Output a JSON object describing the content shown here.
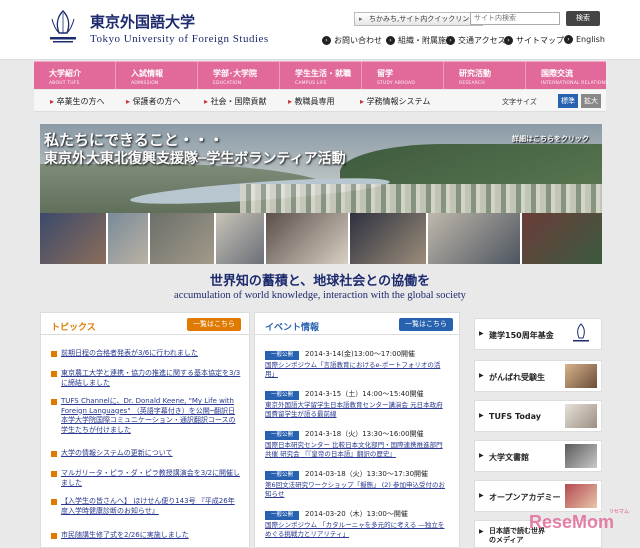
{
  "header": {
    "logo_ja": "東京外国語大学",
    "logo_en": "Tokyo University of Foreign Studies",
    "quicklink": "ちかみち,サイト内クイックリンク",
    "search_placeholder": "サイト内検索",
    "search_button": "検索",
    "util": [
      "お問い合わせ",
      "組織・附属施設",
      "交通アクセス",
      "サイトマップ",
      "English"
    ]
  },
  "nav": [
    {
      "ja": "大学紹介",
      "en": "ABOUT TUFS"
    },
    {
      "ja": "入試情報",
      "en": "ADMISSION"
    },
    {
      "ja": "学部･大学院",
      "en": "EDUCATION"
    },
    {
      "ja": "学生生活・就職",
      "en": "CAMPUS LIFE"
    },
    {
      "ja": "留学",
      "en": "STUDY ABROAD"
    },
    {
      "ja": "研究活動",
      "en": "RESEARCH"
    },
    {
      "ja": "国際交流",
      "en": "INTERNATIONAL RELATIONS"
    }
  ],
  "subnav": [
    "卒業生の方へ",
    "保護者の方へ",
    "社会・国際貢献",
    "教職員専用",
    "学務情報システム"
  ],
  "fontsize": {
    "label": "文字サイズ",
    "normal": "標準",
    "large": "拡大"
  },
  "hero": {
    "line1": "私たちにできること・・・",
    "line2": "東京外大東北復興支援隊─学生ボランティア活動",
    "more": "詳細はこちらをクリック"
  },
  "tagline": {
    "ja": "世界知の蓄積と、地球社会との協働を",
    "en": "accumulation of world knowledge, interaction with the global society"
  },
  "topics": {
    "title": "トピックス",
    "more": "一覧はこちら",
    "items": [
      "前期日程の合格者発表が3/6に行われました",
      "東京農工大学と連携・協力の推進に関する基本協定を3/3に締結しました",
      "TUFS Channelに、Dr. Donald Keene, \"My Life with Foreign Languages\" （英語字幕付き）を公開─翻訳日本学大学院国際コミュニケーション・通訳翻訳コースの学生たちが付けました",
      "大学の情報システムの更新について",
      "マルガリータ・ピラ・ダ・ピラ教授講演会を3/2に開催しました",
      "【入学生の皆さんへ】 ほけせん便り143号 『平成26年度入学時健康診断のお知らせ』",
      "市民随講生修了式を2/26に実施しました"
    ]
  },
  "events": {
    "title": "イベント情報",
    "more": "一覧はこちら",
    "items": [
      {
        "badge": "一般公開",
        "date": "2014-3-14(金)13:00〜17:00開催",
        "title": "国際シンポジウム「言語教育におけるe-ポートフォリオの活用」"
      },
      {
        "badge": "一般公開",
        "date": "2014-3-15（土）14:00〜15:40開催",
        "title": "東京外国語大学留学生日本語教育センター講演会 元日本政府国費留学生が語る最前線"
      },
      {
        "badge": "一般公開",
        "date": "2014-3-18（火）13:30〜16:00開催",
        "title": "国際日本研究センター 比較日本文化部門・国際連携推進部門共催 研究会 『『皇帝の日本語』翻訳の歴史』"
      },
      {
        "badge": "一般公開",
        "date": "2014-03-18（火）13:30〜17:30開催",
        "title": "第6回文法研究ワークショップ「擬態」 (2) 参加申込受付のお知らせ"
      },
      {
        "badge": "一般公開",
        "date": "2014-03-20（木）13:00〜開催",
        "title": "国際シンポジウム 「カタルーニャを多元的に考える ―独立をめぐる挑戦力とリアリティ」"
      }
    ]
  },
  "side": [
    "建学150周年基金",
    "がんばれ受験生",
    "TUFS Today",
    "大学文書館",
    "オープンアカデミー",
    "日本語で読む世界のメディア"
  ],
  "watermark": {
    "brand": "ReseMom",
    "sub": "リセマム"
  },
  "colors": {
    "nav_pink": "#e26a9b",
    "topics_orange": "#e07b00",
    "events_blue": "#2762b0",
    "text_navy": "#1d2b6e"
  }
}
